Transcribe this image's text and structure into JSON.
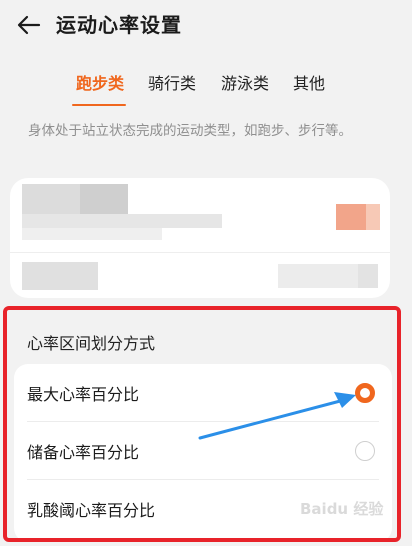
{
  "header": {
    "title": "运动心率设置",
    "back_icon": "back-arrow-icon"
  },
  "tabs": [
    {
      "label": "跑步类",
      "active": true
    },
    {
      "label": "骑行类",
      "active": false
    },
    {
      "label": "游泳类",
      "active": false
    },
    {
      "label": "其他",
      "active": false
    }
  ],
  "description": "身体处于站立状态完成的运动类型，如跑步、步行等。",
  "zone_section": {
    "title": "心率区间划分方式",
    "options": [
      {
        "label": "最大心率百分比",
        "selected": true
      },
      {
        "label": "储备心率百分比",
        "selected": false
      },
      {
        "label": "乳酸阈心率百分比",
        "selected": false
      }
    ]
  },
  "colors": {
    "accent": "#f0671e",
    "annotation_box": "#e8232a",
    "annotation_arrow": "#2b8fe8"
  },
  "watermark": "Baidu 经验"
}
